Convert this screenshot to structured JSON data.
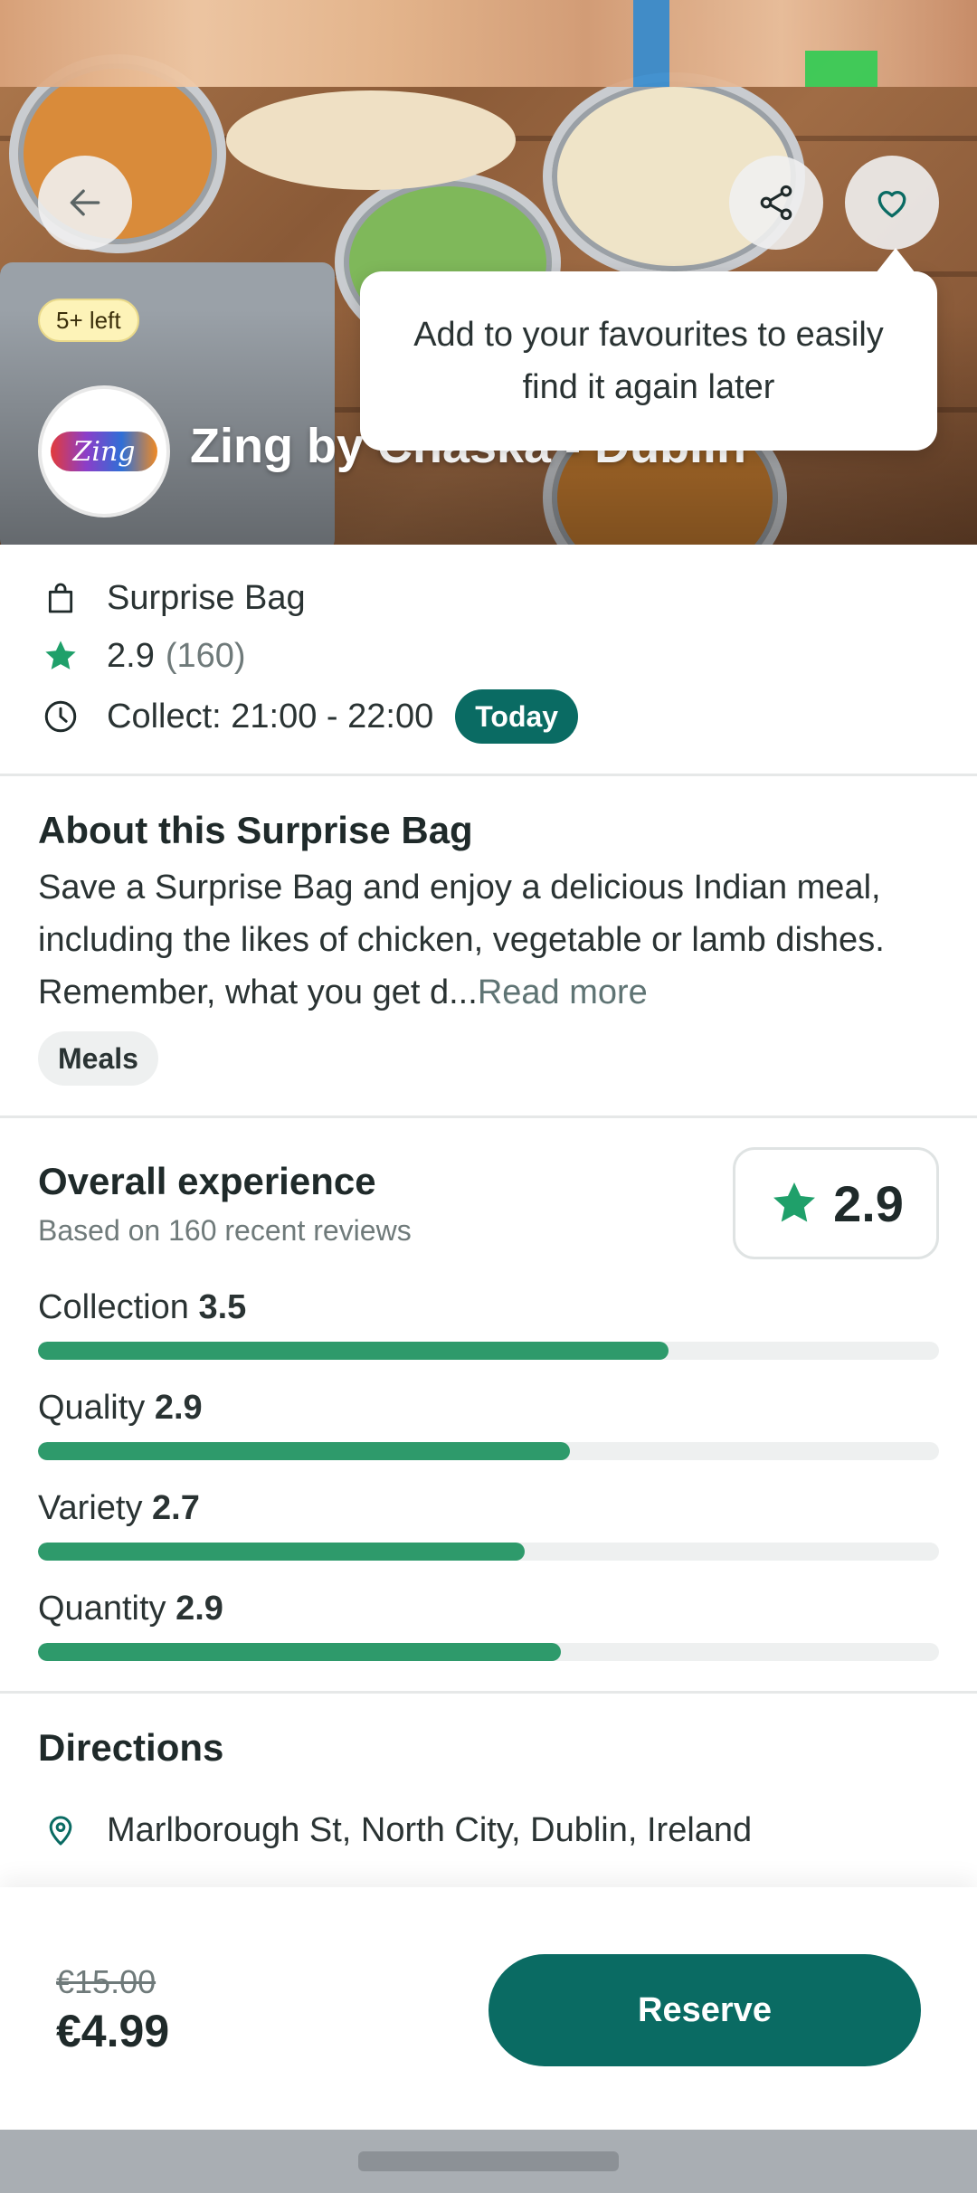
{
  "hero": {
    "items_left_badge": "5+ left",
    "store_name": "Zing by Chaska - Dublin",
    "logo_text": "Zing",
    "tooltip": "Add to your favourites to easily find it again later",
    "icons": {
      "back": "arrow-left-icon",
      "share": "share-icon",
      "favourite": "heart-icon"
    }
  },
  "info": {
    "bag_type": "Surprise Bag",
    "rating": "2.9",
    "rating_count": "(160)",
    "collect": "Collect: 21:00 - 22:00",
    "day_badge": "Today"
  },
  "about": {
    "title": "About this Surprise Bag",
    "text": "Save a Surprise Bag and enjoy a delicious Indian meal, including the likes of chicken, vegetable or lamb dishes. Remember, what you get d...",
    "read_more": "Read more",
    "tag": "Meals"
  },
  "ratings": {
    "title": "Overall experience",
    "subtitle": "Based on 160 recent reviews",
    "overall": "2.9",
    "max": 5,
    "metrics": [
      {
        "label": "Collection",
        "value": "3.5",
        "fill": 0.7
      },
      {
        "label": "Quality",
        "value": "2.9",
        "fill": 0.59
      },
      {
        "label": "Variety",
        "value": "2.7",
        "fill": 0.54
      },
      {
        "label": "Quantity",
        "value": "2.9",
        "fill": 0.58
      }
    ]
  },
  "directions": {
    "title": "Directions",
    "address": "Marlborough St, North City, Dublin, Ireland"
  },
  "footer": {
    "old_price": "€15.00",
    "price": "€4.99",
    "reserve": "Reserve"
  },
  "colors": {
    "brand": "#0a6b63",
    "bar": "#2e9a6b",
    "star": "#1fa06a"
  }
}
